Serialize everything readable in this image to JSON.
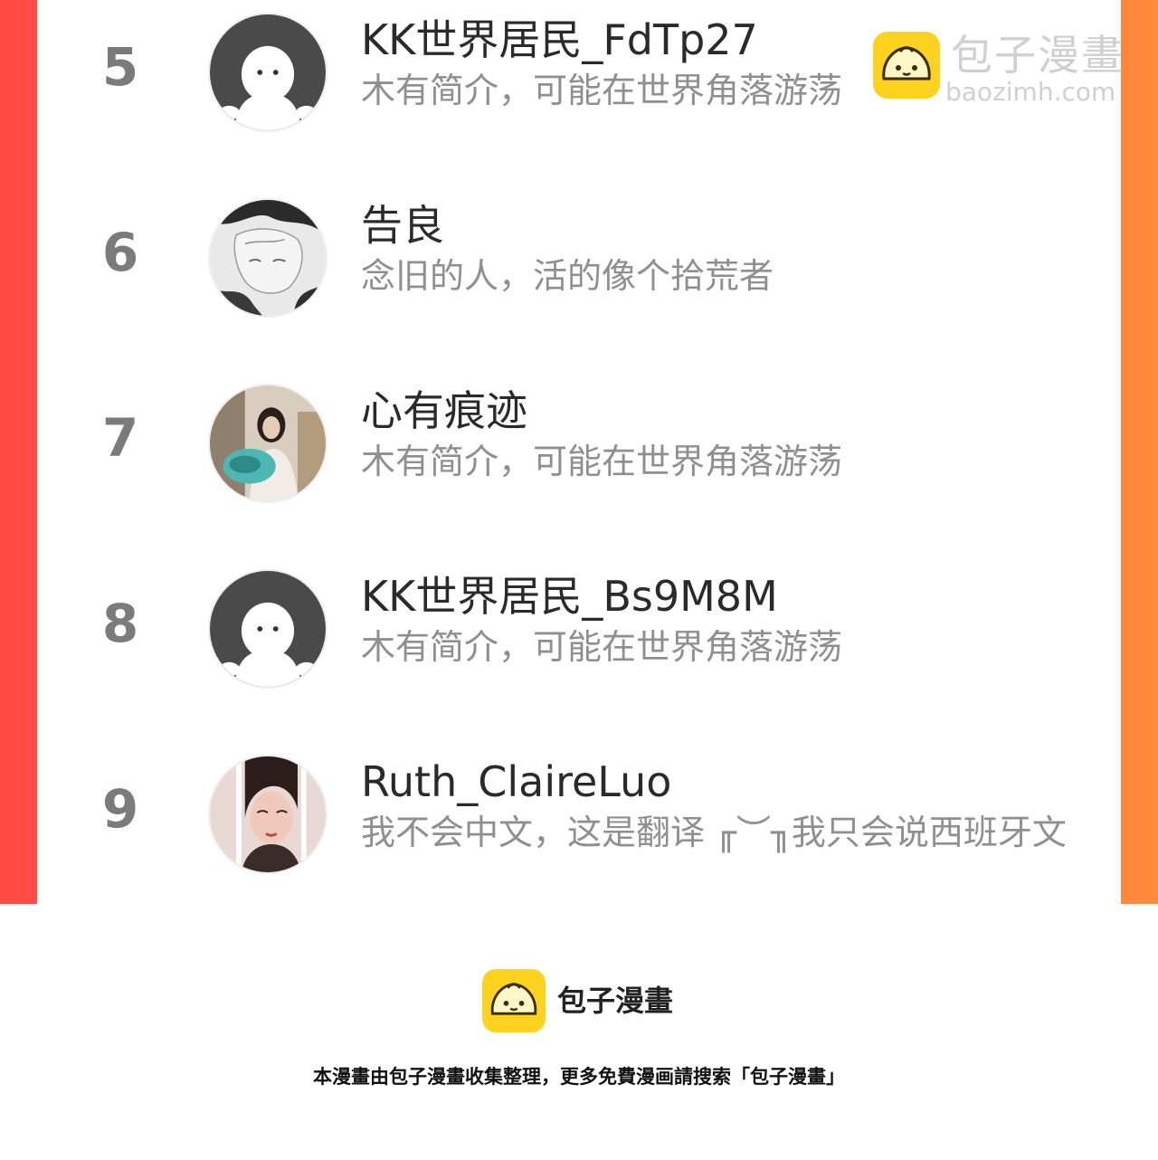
{
  "ranking": [
    {
      "rank": "5",
      "name": "KK世界居民_FdTp27",
      "bio": "木有简介，可能在世界角落游荡",
      "avatar": "default-avatar"
    },
    {
      "rank": "6",
      "name": "告良",
      "bio": "念旧的人，活的像个拾荒者",
      "avatar": "sketch-avatar"
    },
    {
      "rank": "7",
      "name": "心有痕迹",
      "bio": "木有简介，可能在世界角落游荡",
      "avatar": "photo-avatar"
    },
    {
      "rank": "8",
      "name": "KK世界居民_Bs9M8M",
      "bio": "木有简介，可能在世界角落游荡",
      "avatar": "default-avatar"
    },
    {
      "rank": "9",
      "name": "Ruth_ClaireLuo",
      "bio": "我不会中文，这是翻译 ╓︶╖我只会说西班牙文",
      "avatar": "photo-avatar"
    }
  ],
  "watermark": {
    "title": "包子漫畫",
    "domain": "baozimh.com"
  },
  "footer": {
    "brand": "包子漫畫",
    "note": "本漫畫由包子漫畫收集整理，更多免費漫画請搜索「包子漫畫」"
  },
  "colors": {
    "frame_left": "#ff4a46",
    "frame_right": "#ff8a3a",
    "rank": "#7b7b7b",
    "name": "#2a2a2a",
    "bio": "#8f8f8f",
    "logo_yellow": "#ffd21f"
  }
}
